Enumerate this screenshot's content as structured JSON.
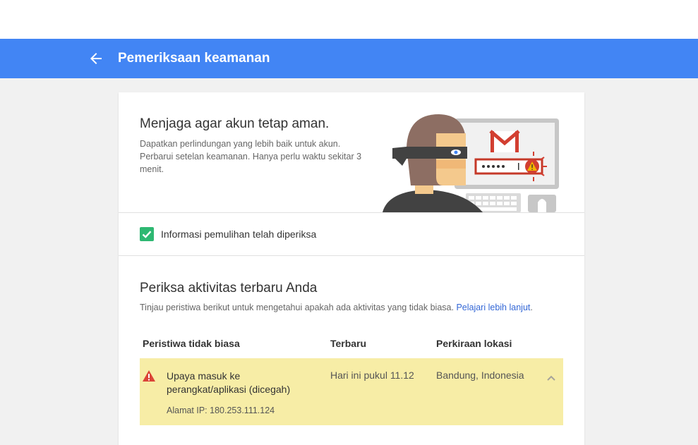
{
  "header": {
    "title": "Pemeriksaan keamanan"
  },
  "intro": {
    "title": "Menjaga agar akun tetap aman.",
    "description": "Dapatkan perlindungan yang lebih baik untuk akun. Perbarui setelan keamanan. Hanya perlu waktu sekitar 3 menit."
  },
  "recovery": {
    "label": "Informasi pemulihan telah diperiksa",
    "checked": true
  },
  "activity": {
    "title": "Periksa aktivitas terbaru Anda",
    "description": "Tinjau peristiwa berikut untuk mengetahui apakah ada aktivitas yang tidak biasa.",
    "learn_more": "Pelajari lebih lanjut",
    "columns": [
      "Peristiwa tidak biasa",
      "Terbaru",
      "Perkiraan lokasi"
    ],
    "events": [
      {
        "name": "Upaya masuk ke perangkat/aplikasi (dicegah)",
        "ip": "Alamat IP: 180.253.111.124",
        "recent": "Hari ini pukul 11.12",
        "location": "Bandung, Indonesia"
      }
    ]
  },
  "colors": {
    "header": "#4285f4",
    "check": "#2eb872",
    "warning_row": "#f7eda6",
    "warning_icon": "#db4437",
    "link": "#3367d6"
  },
  "icons": {
    "back": "arrow-left-icon",
    "check": "checkmark-icon",
    "warning": "warning-triangle-icon",
    "collapse": "chevron-up-icon"
  }
}
